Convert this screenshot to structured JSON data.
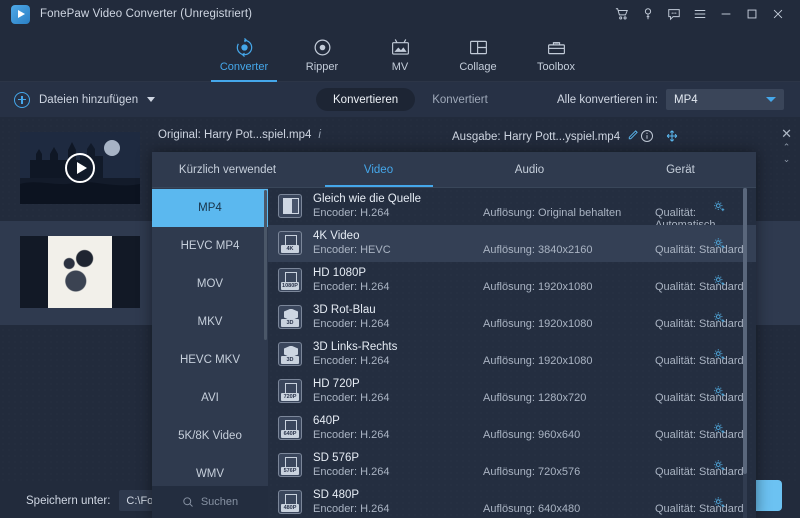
{
  "window": {
    "title": "FonePaw Video Converter (Unregistriert)",
    "logo_icon": "play-logo-icon",
    "controls": [
      {
        "name": "cart-icon",
        "glyph": "cart"
      },
      {
        "name": "key-icon",
        "glyph": "key"
      },
      {
        "name": "feedback-icon",
        "glyph": "chat"
      },
      {
        "name": "menu-icon",
        "glyph": "hamburger"
      },
      {
        "name": "minimize-icon",
        "glyph": "minimize"
      },
      {
        "name": "maximize-icon",
        "glyph": "maximize"
      },
      {
        "name": "close-icon",
        "glyph": "close"
      }
    ]
  },
  "nav": {
    "items": [
      {
        "label": "Converter",
        "icon": "converter-icon",
        "active": true
      },
      {
        "label": "Ripper",
        "icon": "ripper-icon",
        "active": false
      },
      {
        "label": "MV",
        "icon": "mv-icon",
        "active": false
      },
      {
        "label": "Collage",
        "icon": "collage-icon",
        "active": false
      },
      {
        "label": "Toolbox",
        "icon": "toolbox-icon",
        "active": false
      }
    ]
  },
  "actionbar": {
    "add_files_label": "Dateien hinzufügen",
    "add_files_icon": "plus-circle-icon",
    "dropdown_icon": "caret-down-icon",
    "tabs": [
      {
        "label": "Konvertieren",
        "active": true
      },
      {
        "label": "Konvertiert",
        "active": false
      }
    ],
    "convert_all_label": "Alle konvertieren in:",
    "convert_all_value": "MP4"
  },
  "files": [
    {
      "original_label": "Original: Harry Pot...spiel.mp4",
      "info_icon": "info-italic-icon",
      "output_label": "Ausgabe: Harry Pott...yspiel.mp4",
      "edit_icon": "pencil-icon",
      "detail_icon": "info-circle-icon",
      "move_icon": "move-icon",
      "close_icon": "close-icon",
      "up_icon": "chevron-up-icon",
      "down_icon": "chevron-down-icon",
      "selected": false
    },
    {
      "original_label": "",
      "output_label": "",
      "selected": true
    }
  ],
  "bottombar": {
    "save_label": "Speichern unter:",
    "save_path": "C:\\FonePa",
    "convert_button": ""
  },
  "format_panel": {
    "tabs": [
      {
        "label": "Kürzlich verwendet",
        "active": false
      },
      {
        "label": "Video",
        "active": true
      },
      {
        "label": "Audio",
        "active": false
      },
      {
        "label": "Gerät",
        "active": false
      }
    ],
    "sidebar": [
      {
        "label": "MP4",
        "active": true
      },
      {
        "label": "HEVC MP4",
        "active": false
      },
      {
        "label": "MOV",
        "active": false
      },
      {
        "label": "MKV",
        "active": false
      },
      {
        "label": "HEVC MKV",
        "active": false
      },
      {
        "label": "AVI",
        "active": false
      },
      {
        "label": "5K/8K Video",
        "active": false
      },
      {
        "label": "WMV",
        "active": false
      }
    ],
    "search_placeholder": "Suchen",
    "search_icon": "search-icon",
    "rows": [
      {
        "name": "Gleich wie die Quelle",
        "encoder": "Encoder: H.264",
        "resolution": "Auflösung: Original behalten",
        "quality": "Qualität: Automatisch",
        "icon": "source-format-icon",
        "badge": "",
        "icon_style": "source",
        "selected": false
      },
      {
        "name": "4K Video",
        "encoder": "Encoder: HEVC",
        "resolution": "Auflösung: 3840x2160",
        "quality": "Qualität: Standard",
        "icon": "film-4k-icon",
        "badge": "4K",
        "icon_style": "film",
        "selected": true
      },
      {
        "name": "HD 1080P",
        "encoder": "Encoder: H.264",
        "resolution": "Auflösung: 1920x1080",
        "quality": "Qualität: Standard",
        "icon": "film-1080p-icon",
        "badge": "1080P",
        "icon_style": "film",
        "selected": false
      },
      {
        "name": "3D Rot-Blau",
        "encoder": "Encoder: H.264",
        "resolution": "Auflösung: 1920x1080",
        "quality": "Qualität: Standard",
        "icon": "cube-3d-icon",
        "badge": "3D",
        "icon_style": "cube",
        "selected": false
      },
      {
        "name": "3D Links-Rechts",
        "encoder": "Encoder: H.264",
        "resolution": "Auflösung: 1920x1080",
        "quality": "Qualität: Standard",
        "icon": "cube-3d-icon",
        "badge": "3D",
        "icon_style": "cube",
        "selected": false
      },
      {
        "name": "HD 720P",
        "encoder": "Encoder: H.264",
        "resolution": "Auflösung: 1280x720",
        "quality": "Qualität: Standard",
        "icon": "film-720p-icon",
        "badge": "720P",
        "icon_style": "film",
        "selected": false
      },
      {
        "name": "640P",
        "encoder": "Encoder: H.264",
        "resolution": "Auflösung: 960x640",
        "quality": "Qualität: Standard",
        "icon": "film-640p-icon",
        "badge": "640P",
        "icon_style": "film",
        "selected": false
      },
      {
        "name": "SD 576P",
        "encoder": "Encoder: H.264",
        "resolution": "Auflösung: 720x576",
        "quality": "Qualität: Standard",
        "icon": "film-576p-icon",
        "badge": "576P",
        "icon_style": "film",
        "selected": false
      },
      {
        "name": "SD 480P",
        "encoder": "Encoder: H.264",
        "resolution": "Auflösung: 640x480",
        "quality": "Qualität: Standard",
        "icon": "film-480p-icon",
        "badge": "480P",
        "icon_style": "film",
        "selected": false
      }
    ],
    "gear_icon": "gear-plus-icon"
  },
  "colors": {
    "accent": "#45a7ea",
    "highlight": "#5bb8ef",
    "bg": "#222b3c",
    "panel": "#2c374b",
    "row_selected": "#344055"
  }
}
